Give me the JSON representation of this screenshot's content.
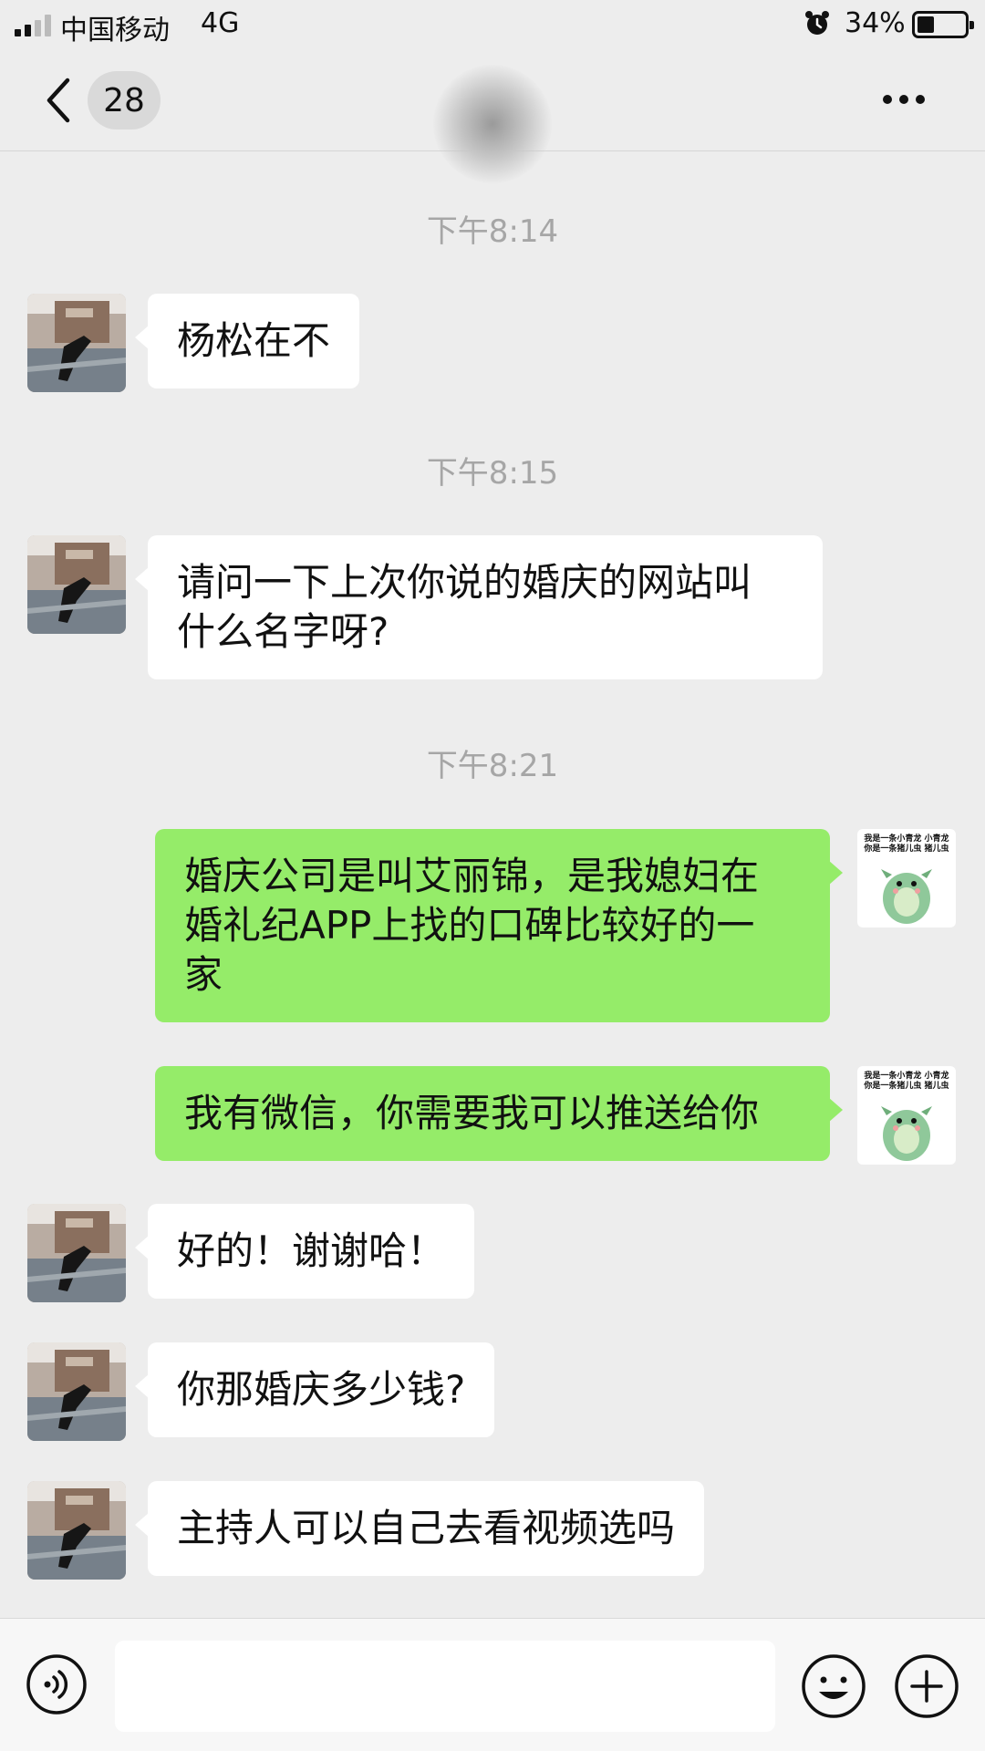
{
  "status_bar": {
    "carrier": "中国移动",
    "network": "4G",
    "battery_percent": "34%",
    "battery_level": 0.34,
    "icons": [
      "signal-icon",
      "alarm-clock-icon",
      "battery-icon"
    ]
  },
  "nav": {
    "unread_count": "28",
    "icons": [
      "back-chevron-icon",
      "more-dots-icon"
    ]
  },
  "timestamps": [
    "下午8:14",
    "下午8:15",
    "下午8:21"
  ],
  "messages": [
    {
      "side": "in",
      "lines": [
        "杨松在不"
      ]
    },
    {
      "side": "in",
      "lines": [
        "请问一下上次你说的婚庆的网站叫",
        "什么名字呀?"
      ]
    },
    {
      "side": "out",
      "lines": [
        "婚庆公司是叫艾丽锦，是我媳妇在",
        "婚礼纪APP上找的口碑比较好的一",
        "家"
      ]
    },
    {
      "side": "out",
      "lines": [
        "我有微信，你需要我可以推送给你"
      ]
    },
    {
      "side": "in",
      "lines": [
        "好的！谢谢哈！"
      ]
    },
    {
      "side": "in",
      "lines": [
        "你那婚庆多少钱?"
      ]
    },
    {
      "side": "in",
      "lines": [
        "主持人可以自己去看视频选吗"
      ]
    }
  ],
  "my_avatar": {
    "caption_line1": "我是一条小青龙 小青龙",
    "caption_line2": "你是一条猪儿虫 猪儿虫"
  },
  "input_bar": {
    "input_value": "",
    "icons": [
      "voice-icon",
      "emoji-icon",
      "plus-icon"
    ]
  },
  "colors": {
    "background": "#ededed",
    "incoming_bubble": "#ffffff",
    "outgoing_bubble": "#95ec69",
    "timestamp_text": "#a6a6a6"
  }
}
